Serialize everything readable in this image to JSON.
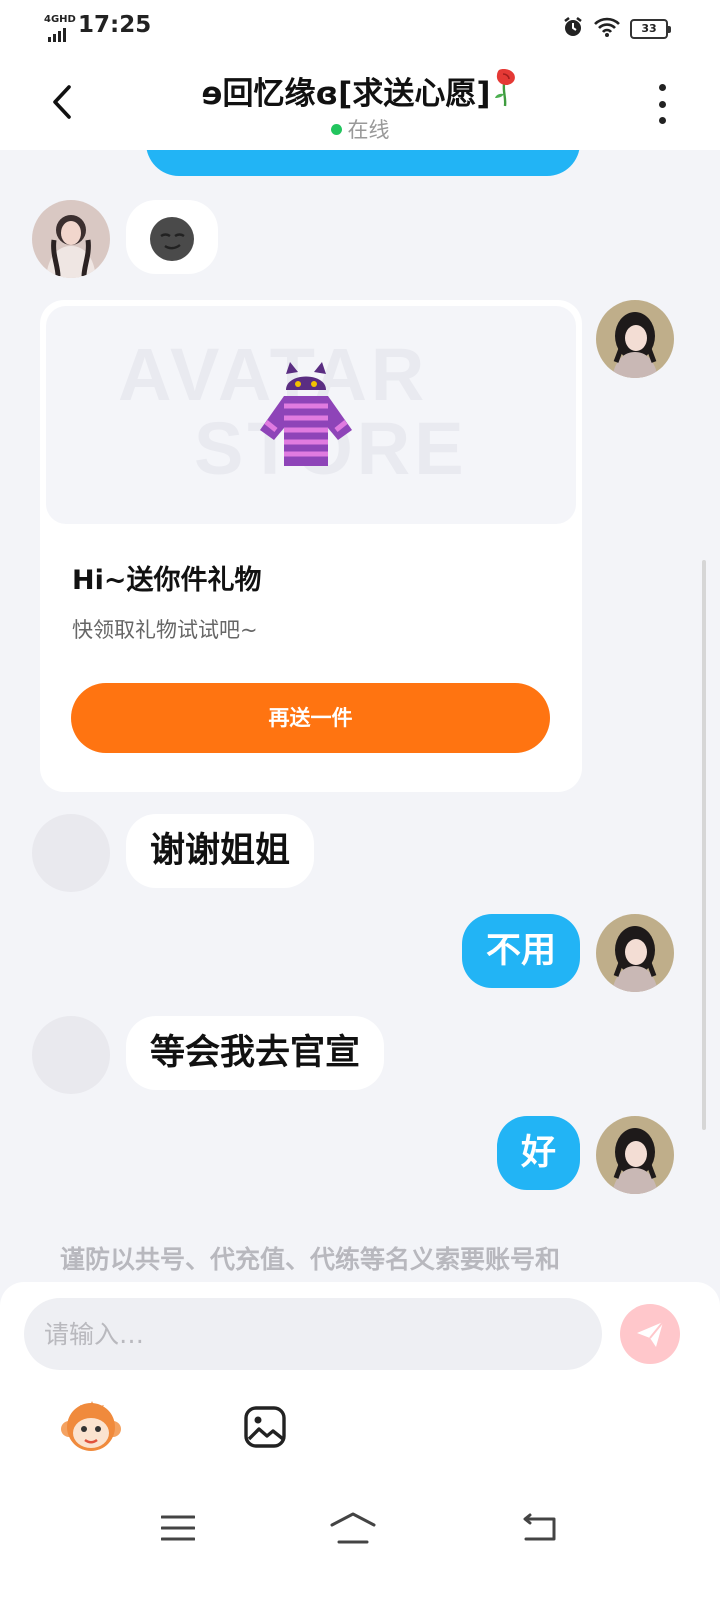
{
  "status_bar": {
    "network": "4GHD",
    "time": "17:25",
    "battery": "33"
  },
  "header": {
    "title": "ɘ回忆缘ɞ[求送心愿]",
    "status": "在线"
  },
  "chat": {
    "messages": [
      {
        "side": "in",
        "text": "谢谢姐姐"
      },
      {
        "side": "out",
        "text": "不用"
      },
      {
        "side": "in",
        "text": "等会我去官宣"
      },
      {
        "side": "out",
        "text": "好"
      }
    ],
    "gift_card": {
      "watermark_line1": "AVATAR",
      "watermark_line2": "STORE",
      "title": "Hi~送你件礼物",
      "subtitle": "快领取礼物试试吧~",
      "button": "再送一件"
    },
    "notice": "谨防以共号、代充值、代练等名义索要账号和"
  },
  "input": {
    "placeholder": "请输入…"
  },
  "colors": {
    "accent_blue": "#22b4f5",
    "gift_button": "#ff7411",
    "send_button": "#ffc7cb",
    "online_dot": "#22c55e"
  },
  "icons": [
    "back-arrow-icon",
    "more-vertical-icon",
    "rose-icon",
    "emoji-icon",
    "sweater-icon",
    "send-icon",
    "monkey-sticker-icon",
    "image-icon",
    "menu-icon",
    "home-icon",
    "back-icon"
  ]
}
